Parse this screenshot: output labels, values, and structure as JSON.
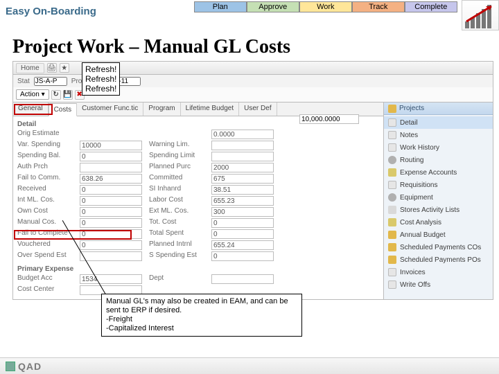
{
  "brand": "Easy On-Boarding",
  "phases": {
    "plan": "Plan",
    "approve": "Approve",
    "work": "Work",
    "track": "Track",
    "complete": "Complete"
  },
  "slide_title": "Project Work – Manual GL Costs",
  "toolbar": {
    "home": "Home",
    "print_icon": "🖨",
    "star_icon": "★"
  },
  "infobar": {
    "stat": "Stat",
    "stat_val": "JS-A-P",
    "proj_lbl": "Project No",
    "proj_val": "CP-11"
  },
  "action": {
    "label": "Action",
    "ic_refresh": "↻",
    "ic_save": "💾",
    "ic_del": "✖"
  },
  "tabs": {
    "general": "General",
    "costs": "Costs",
    "customer": "Customer Func.tic",
    "program": "Program",
    "lifetime": "Lifetime Budget",
    "userdef": "User Def"
  },
  "refresh_callout": {
    "l1": "Refresh!",
    "l2": "Refresh!",
    "l3": "Refresh!"
  },
  "form": {
    "head_detail": "Detail",
    "orig_est_lbl": "Orig Estimate",
    "orig_est_r_lbl": "",
    "orig_est_r": "0.0000",
    "orig_est_far_lbl": "",
    "orig_est_far": "10,000.0000",
    "var_spend_lbl": "Var. Spending",
    "var_spend": "10000",
    "warn_lbl": "Warning Lim.",
    "warn": "",
    "spend_bal_lbl": "Spending Bal.",
    "spend_bal": "0",
    "spend_limit_lbl": "Spending Limit",
    "spend_limit": "",
    "auth_lbl": "Auth Prch",
    "auth": "",
    "planned_lbl": "Planned Purc",
    "planned": "2000",
    "fail_comm_lbl": "Fail to Comm.",
    "fail_comm": "638.26",
    "committed_lbl": "Committed",
    "committed": "675",
    "received_lbl": "Received",
    "received": "0",
    "sl_inhand_lbl": "SI Inhanrd",
    "sl_inhand": "38.51",
    "int_ml_lbl": "Int ML. Cos.",
    "int_ml": "0",
    "labor_lbl": "Labor Cost",
    "labor": "655.23",
    "own_cost_lbl": "Own Cost",
    "own_cost": "0",
    "ext_ml_lbl": "Ext ML. Cos.",
    "ext_ml": "300",
    "manual_lbl": "Manual Cos.",
    "manual": "0",
    "tot_cost_lbl": "Tot. Cost",
    "tot_cost": "0",
    "fail_compl_lbl": "Fail to Complete",
    "fail_compl": "0",
    "total_spent_lbl": "Total Spent",
    "total_spent": "0",
    "vouchered_lbl": "Vouchered",
    "vouchered": "0",
    "planned_intrnl_lbl": "Planned Intrnl",
    "planned_intrnl": "655.24",
    "over_spend_lbl": "Over Spend Est",
    "over_spend": "",
    "sspend_lbl": "S Spending Est",
    "sspend": "0",
    "primary_exp_lbl": "Primary Expense",
    "budget_acc_lbl": "Budget Acc",
    "budget_acc": "1534",
    "dept_lbl": "Dept",
    "dept": "",
    "cost_center_lbl": "Cost Center",
    "cost_center": ""
  },
  "note": {
    "l1": "Manual GL's may also be created in EAM, and can be",
    "l2": "sent to ERP if desired.",
    "l3": "-Freight",
    "l4": "-Capitalized Interest"
  },
  "side": {
    "projects": "Projects",
    "items": {
      "detail": "Detail",
      "notes": "Notes",
      "work": "Work History",
      "routing": "Routing",
      "expense": "Expense Accounts",
      "req": "Requisitions",
      "equip": "Equipment",
      "stores": "Stores Activity Lists",
      "cost": "Cost Analysis",
      "annual": "Annual Budget",
      "sched_co": "Scheduled Payments COs",
      "sched_po": "Scheduled Payments POs",
      "invoices": "Invoices",
      "writeoffs": "Write Offs"
    }
  },
  "footer": {
    "brand": "QAD"
  }
}
